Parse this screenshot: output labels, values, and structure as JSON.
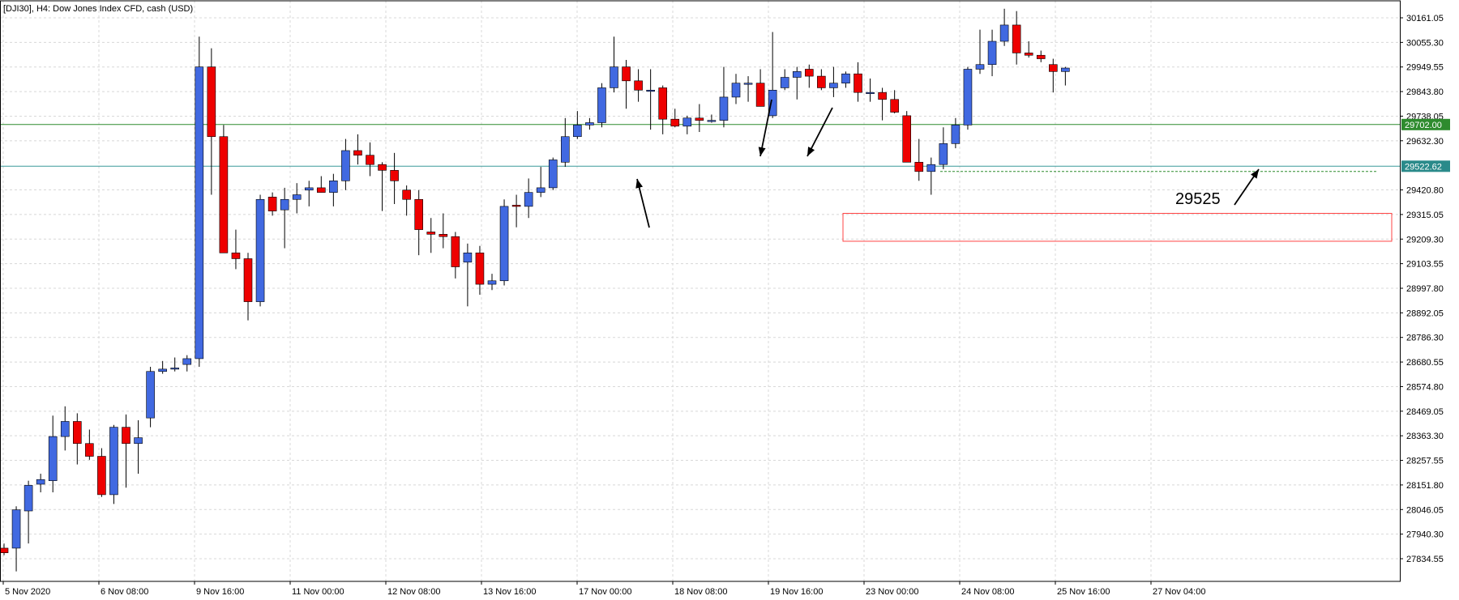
{
  "chart_data": {
    "type": "candlestick",
    "title": "[DJI30], H4:  Dow Jones Index CFD, cash (USD)",
    "ylim": [
      27730,
      30230
    ],
    "y_ticks": [
      "30161.05",
      "30055.30",
      "29949.55",
      "29843.80",
      "29738.05",
      "29632.30",
      "29522.62",
      "29420.80",
      "29315.05",
      "29209.30",
      "29103.55",
      "28997.80",
      "28892.05",
      "28786.30",
      "28680.55",
      "28574.80",
      "28469.05",
      "28363.30",
      "28257.55",
      "28151.80",
      "28046.05",
      "27940.30",
      "27834.55"
    ],
    "x_ticks": [
      "5 Nov 2020",
      "6 Nov 08:00",
      "9 Nov 16:00",
      "11 Nov 00:00",
      "12 Nov 08:00",
      "13 Nov 16:00",
      "17 Nov 00:00",
      "18 Nov 08:00",
      "19 Nov 16:00",
      "23 Nov 00:00",
      "24 Nov 08:00",
      "25 Nov 16:00",
      "27 Nov 04:00"
    ],
    "colors": {
      "up": "#4169e1",
      "down": "#ee0000",
      "wick": "#000000",
      "green_line": "#2e8b2e",
      "teal_line": "#3a9a9a",
      "zone": "#ff4444"
    },
    "candles": [
      {
        "o": 27880,
        "h": 27900,
        "l": 27850,
        "c": 27860
      },
      {
        "o": 27880,
        "h": 28060,
        "l": 27780,
        "c": 28045
      },
      {
        "o": 28040,
        "h": 28170,
        "l": 27900,
        "c": 28150
      },
      {
        "o": 28155,
        "h": 28200,
        "l": 28120,
        "c": 28175
      },
      {
        "o": 28170,
        "h": 28450,
        "l": 28120,
        "c": 28360
      },
      {
        "o": 28360,
        "h": 28490,
        "l": 28300,
        "c": 28425
      },
      {
        "o": 28425,
        "h": 28460,
        "l": 28240,
        "c": 28330
      },
      {
        "o": 28330,
        "h": 28390,
        "l": 28260,
        "c": 28275
      },
      {
        "o": 28275,
        "h": 28310,
        "l": 28100,
        "c": 28110
      },
      {
        "o": 28110,
        "h": 28410,
        "l": 28070,
        "c": 28400
      },
      {
        "o": 28400,
        "h": 28455,
        "l": 28140,
        "c": 28330
      },
      {
        "o": 28330,
        "h": 28430,
        "l": 28200,
        "c": 28355
      },
      {
        "o": 28440,
        "h": 28660,
        "l": 28400,
        "c": 28640
      },
      {
        "o": 28640,
        "h": 28685,
        "l": 28630,
        "c": 28650
      },
      {
        "o": 28650,
        "h": 28700,
        "l": 28640,
        "c": 28655
      },
      {
        "o": 28670,
        "h": 28710,
        "l": 28640,
        "c": 28695
      },
      {
        "o": 28695,
        "h": 30080,
        "l": 28660,
        "c": 29950
      },
      {
        "o": 29950,
        "h": 30030,
        "l": 29400,
        "c": 29650
      },
      {
        "o": 29650,
        "h": 29700,
        "l": 29150,
        "c": 29150
      },
      {
        "o": 29150,
        "h": 29250,
        "l": 29080,
        "c": 29125
      },
      {
        "o": 29125,
        "h": 29150,
        "l": 28860,
        "c": 28940
      },
      {
        "o": 28940,
        "h": 29400,
        "l": 28920,
        "c": 29380
      },
      {
        "o": 29390,
        "h": 29410,
        "l": 29310,
        "c": 29330
      },
      {
        "o": 29335,
        "h": 29430,
        "l": 29170,
        "c": 29380
      },
      {
        "o": 29380,
        "h": 29450,
        "l": 29320,
        "c": 29400
      },
      {
        "o": 29420,
        "h": 29460,
        "l": 29350,
        "c": 29430
      },
      {
        "o": 29430,
        "h": 29480,
        "l": 29410,
        "c": 29410
      },
      {
        "o": 29410,
        "h": 29490,
        "l": 29350,
        "c": 29460
      },
      {
        "o": 29460,
        "h": 29640,
        "l": 29420,
        "c": 29590
      },
      {
        "o": 29590,
        "h": 29660,
        "l": 29530,
        "c": 29570
      },
      {
        "o": 29570,
        "h": 29625,
        "l": 29480,
        "c": 29530
      },
      {
        "o": 29530,
        "h": 29540,
        "l": 29330,
        "c": 29505
      },
      {
        "o": 29505,
        "h": 29580,
        "l": 29360,
        "c": 29460
      },
      {
        "o": 29420,
        "h": 29440,
        "l": 29310,
        "c": 29380
      },
      {
        "o": 29380,
        "h": 29420,
        "l": 29140,
        "c": 29250
      },
      {
        "o": 29240,
        "h": 29300,
        "l": 29150,
        "c": 29230
      },
      {
        "o": 29230,
        "h": 29320,
        "l": 29170,
        "c": 29220
      },
      {
        "o": 29220,
        "h": 29240,
        "l": 29040,
        "c": 29090
      },
      {
        "o": 29110,
        "h": 29190,
        "l": 28920,
        "c": 29150
      },
      {
        "o": 29150,
        "h": 29180,
        "l": 28970,
        "c": 29015
      },
      {
        "o": 29015,
        "h": 29060,
        "l": 28990,
        "c": 29030
      },
      {
        "o": 29030,
        "h": 29380,
        "l": 29010,
        "c": 29350
      },
      {
        "o": 29355,
        "h": 29400,
        "l": 29260,
        "c": 29350
      },
      {
        "o": 29350,
        "h": 29470,
        "l": 29300,
        "c": 29410
      },
      {
        "o": 29410,
        "h": 29520,
        "l": 29390,
        "c": 29430
      },
      {
        "o": 29430,
        "h": 29560,
        "l": 29420,
        "c": 29550
      },
      {
        "o": 29540,
        "h": 29730,
        "l": 29520,
        "c": 29650
      },
      {
        "o": 29650,
        "h": 29760,
        "l": 29640,
        "c": 29700
      },
      {
        "o": 29700,
        "h": 29730,
        "l": 29680,
        "c": 29710
      },
      {
        "o": 29710,
        "h": 29880,
        "l": 29690,
        "c": 29860
      },
      {
        "o": 29860,
        "h": 30080,
        "l": 29840,
        "c": 29950
      },
      {
        "o": 29950,
        "h": 29980,
        "l": 29770,
        "c": 29890
      },
      {
        "o": 29890,
        "h": 29940,
        "l": 29800,
        "c": 29850
      },
      {
        "o": 29850,
        "h": 29940,
        "l": 29680,
        "c": 29850
      },
      {
        "o": 29860,
        "h": 29870,
        "l": 29660,
        "c": 29725
      },
      {
        "o": 29725,
        "h": 29770,
        "l": 29690,
        "c": 29695
      },
      {
        "o": 29695,
        "h": 29740,
        "l": 29660,
        "c": 29730
      },
      {
        "o": 29730,
        "h": 29790,
        "l": 29670,
        "c": 29720
      },
      {
        "o": 29720,
        "h": 29745,
        "l": 29710,
        "c": 29720
      },
      {
        "o": 29720,
        "h": 29950,
        "l": 29690,
        "c": 29820
      },
      {
        "o": 29820,
        "h": 29920,
        "l": 29790,
        "c": 29880
      },
      {
        "o": 29880,
        "h": 29910,
        "l": 29800,
        "c": 29880
      },
      {
        "o": 29880,
        "h": 29940,
        "l": 29780,
        "c": 29780
      },
      {
        "o": 29740,
        "h": 30100,
        "l": 29730,
        "c": 29850
      },
      {
        "o": 29860,
        "h": 29940,
        "l": 29850,
        "c": 29905
      },
      {
        "o": 29905,
        "h": 29950,
        "l": 29810,
        "c": 29930
      },
      {
        "o": 29940,
        "h": 29960,
        "l": 29860,
        "c": 29910
      },
      {
        "o": 29910,
        "h": 29940,
        "l": 29850,
        "c": 29860
      },
      {
        "o": 29860,
        "h": 29950,
        "l": 29820,
        "c": 29880
      },
      {
        "o": 29880,
        "h": 29930,
        "l": 29860,
        "c": 29920
      },
      {
        "o": 29920,
        "h": 29970,
        "l": 29800,
        "c": 29840
      },
      {
        "o": 29840,
        "h": 29900,
        "l": 29800,
        "c": 29840
      },
      {
        "o": 29840,
        "h": 29860,
        "l": 29720,
        "c": 29810
      },
      {
        "o": 29810,
        "h": 29850,
        "l": 29750,
        "c": 29755
      },
      {
        "o": 29740,
        "h": 29760,
        "l": 29540,
        "c": 29540
      },
      {
        "o": 29540,
        "h": 29640,
        "l": 29460,
        "c": 29500
      },
      {
        "o": 29500,
        "h": 29560,
        "l": 29400,
        "c": 29530
      },
      {
        "o": 29530,
        "h": 29690,
        "l": 29510,
        "c": 29620
      },
      {
        "o": 29620,
        "h": 29730,
        "l": 29600,
        "c": 29700
      },
      {
        "o": 29700,
        "h": 29950,
        "l": 29680,
        "c": 29940
      },
      {
        "o": 29940,
        "h": 30110,
        "l": 29920,
        "c": 29960
      },
      {
        "o": 29960,
        "h": 30110,
        "l": 29910,
        "c": 30060
      },
      {
        "o": 30060,
        "h": 30200,
        "l": 30040,
        "c": 30130
      },
      {
        "o": 30130,
        "h": 30190,
        "l": 29960,
        "c": 30010
      },
      {
        "o": 30010,
        "h": 30060,
        "l": 29990,
        "c": 30000
      },
      {
        "o": 30000,
        "h": 30020,
        "l": 29970,
        "c": 29985
      },
      {
        "o": 29960,
        "h": 29985,
        "l": 29840,
        "c": 29930
      },
      {
        "o": 29930,
        "h": 29950,
        "l": 29870,
        "c": 29945
      }
    ],
    "levels": {
      "green": 29702.0,
      "teal": 29522.62,
      "dotted": 29500
    },
    "zone": {
      "top": 29320,
      "bottom": 29200
    },
    "annotation": "29525",
    "badges": {
      "green": "29702.00",
      "teal": "29522.62"
    }
  }
}
